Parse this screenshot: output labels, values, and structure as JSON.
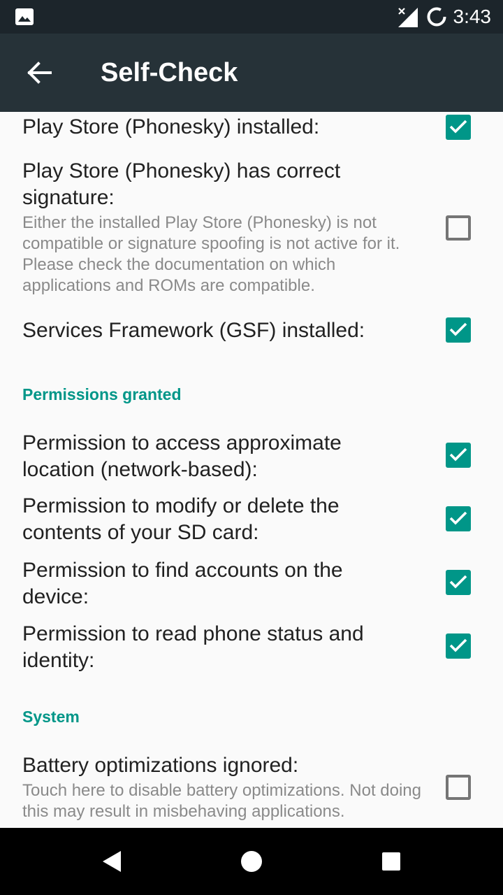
{
  "status_bar": {
    "time": "3:43",
    "icons": [
      "image-icon",
      "signal-icon",
      "battery-icon"
    ]
  },
  "toolbar": {
    "title": "Self-Check",
    "back_icon": "arrow-back-icon"
  },
  "colors": {
    "accent": "#009688",
    "toolbar": "#263238",
    "status_bar": "#1c252b",
    "background": "#fafafa"
  },
  "checks": [
    {
      "label": "Play Store (Phonesky) installed:",
      "summary": "",
      "checked": true
    },
    {
      "label": "Play Store (Phonesky) has correct signature:",
      "summary": "Either the installed Play Store (Phonesky) is not compatible or signature spoofing is not active for it. Please check the documentation on which applications and ROMs are compatible.",
      "checked": false
    },
    {
      "label": "Services Framework (GSF) installed:",
      "summary": "",
      "checked": true
    }
  ],
  "permissions": {
    "header": "Permissions granted",
    "items": [
      {
        "label": "Permission to access approximate location (network-based):",
        "checked": true
      },
      {
        "label": "Permission to modify or delete the contents of your SD card:",
        "checked": true
      },
      {
        "label": "Permission to find accounts on the device:",
        "checked": true
      },
      {
        "label": "Permission to read phone status and identity:",
        "checked": true
      }
    ]
  },
  "system": {
    "header": "System",
    "items": [
      {
        "label": "Battery optimizations ignored:",
        "summary": "Touch here to disable battery optimizations. Not doing this may result in misbehaving applications.",
        "checked": false
      }
    ]
  },
  "nav_bar": {
    "icons": [
      "back-triangle-icon",
      "home-circle-icon",
      "recents-square-icon"
    ]
  }
}
